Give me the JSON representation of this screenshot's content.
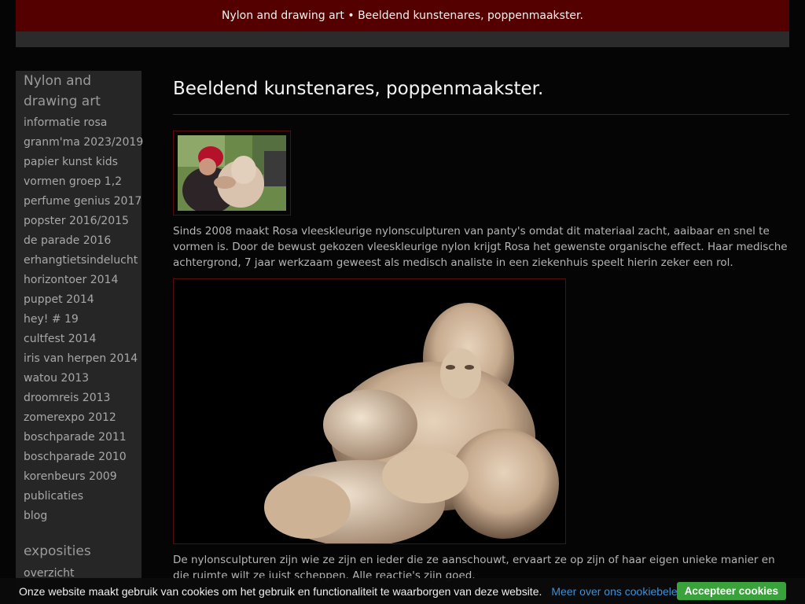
{
  "header": {
    "title": "Nylon and drawing art • Beeldend kunstenares, poppenmaakster."
  },
  "sidebar": {
    "title": "Nylon and drawing art",
    "items": [
      {
        "label": "informatie rosa"
      },
      {
        "label": "granm'ma 2023/2019"
      },
      {
        "label": "papier kunst kids"
      },
      {
        "label": "vormen groep 1,2"
      },
      {
        "label": "perfume genius 2017"
      },
      {
        "label": "popster 2016/2015"
      },
      {
        "label": "de parade 2016"
      },
      {
        "label": "erhangtietsindelucht"
      },
      {
        "label": "horizontoer 2014"
      },
      {
        "label": "puppet 2014"
      },
      {
        "label": "hey! # 19"
      },
      {
        "label": "cultfest 2014"
      },
      {
        "label": "iris van herpen 2014"
      },
      {
        "label": "watou 2013"
      },
      {
        "label": "droomreis 2013"
      },
      {
        "label": "zomerexpo 2012"
      },
      {
        "label": "boschparade 2011"
      },
      {
        "label": "boschparade 2010"
      },
      {
        "label": "korenbeurs 2009"
      },
      {
        "label": "publicaties"
      },
      {
        "label": "blog"
      }
    ],
    "section2": {
      "title": "exposities",
      "items": [
        {
          "label": "overzicht"
        }
      ]
    }
  },
  "main": {
    "title": "Beeldend kunstenares, poppenmaakster.",
    "para1": "Sinds 2008 maakt Rosa vleeskleurige nylonsculpturen van panty's  omdat dit materiaal zacht, aaibaar en snel te vormen is.  Door de bewust gekozen vleeskleurige nylon krijgt Rosa het gewenste organische effect.  Haar medische achtergrond, 7 jaar werkzaam geweest als medisch analiste in een ziekenhuis  speelt hierin zeker een rol.",
    "para2": "De nylonsculpturen zijn wie ze zijn en ieder die ze aanschouwt, ervaart ze op zijn of haar eigen unieke manier en die ruimte wilt ze juist scheppen. Alle reactie's zijn goed."
  },
  "cookie": {
    "text": "Onze website maakt gebruik van cookies om het gebruik en functionaliteit te waarborgen van deze website.",
    "link": "Meer over ons cookiebeleid",
    "button": "Accepteer cookies"
  },
  "colors": {
    "header_bg": "#550000",
    "accent_border": "#5a0a0a",
    "cookie_button": "#3aa23a",
    "cookie_link": "#3c8fd8"
  }
}
